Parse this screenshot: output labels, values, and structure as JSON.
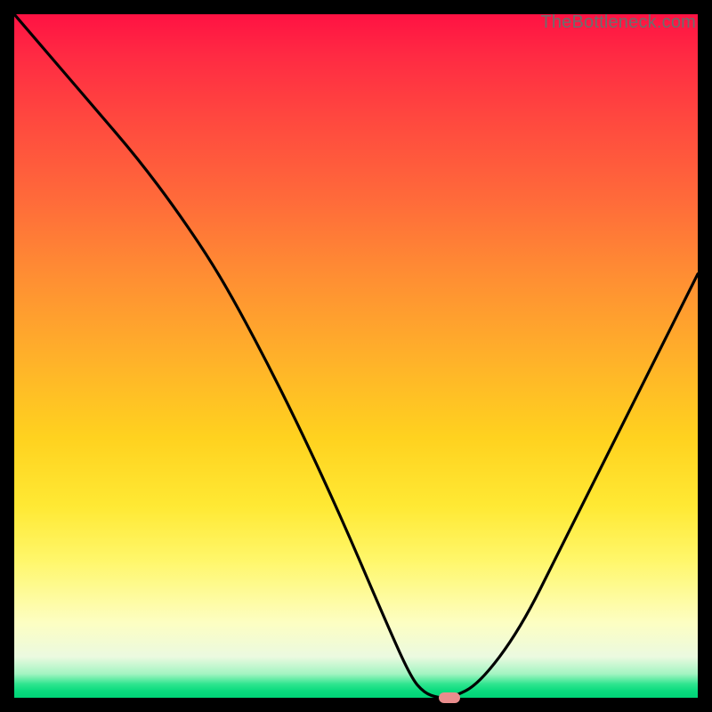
{
  "watermark": "TheBottleneck.com",
  "colors": {
    "background": "#000000",
    "curve": "#000000",
    "marker": "#e98d8d"
  },
  "chart_data": {
    "type": "line",
    "title": "",
    "xlabel": "",
    "ylabel": "",
    "xlim": [
      0,
      100
    ],
    "ylim": [
      0,
      100
    ],
    "x": [
      0,
      6,
      12,
      18,
      24,
      30,
      36,
      42,
      48,
      54,
      58,
      60,
      62,
      64,
      68,
      74,
      80,
      86,
      92,
      100
    ],
    "values": [
      100,
      93,
      86,
      79,
      71,
      62,
      51,
      39,
      26,
      12,
      3,
      0.7,
      0,
      0,
      2,
      10,
      22,
      34,
      46,
      62
    ],
    "marker": {
      "x": 63.5,
      "y": 0.3
    },
    "gradient_stops": [
      {
        "pos": 0.0,
        "color": "#ff1243"
      },
      {
        "pos": 0.5,
        "color": "#ffb02a"
      },
      {
        "pos": 0.8,
        "color": "#fff76b"
      },
      {
        "pos": 0.97,
        "color": "#2fe58f"
      },
      {
        "pos": 1.0,
        "color": "#00d477"
      }
    ]
  }
}
